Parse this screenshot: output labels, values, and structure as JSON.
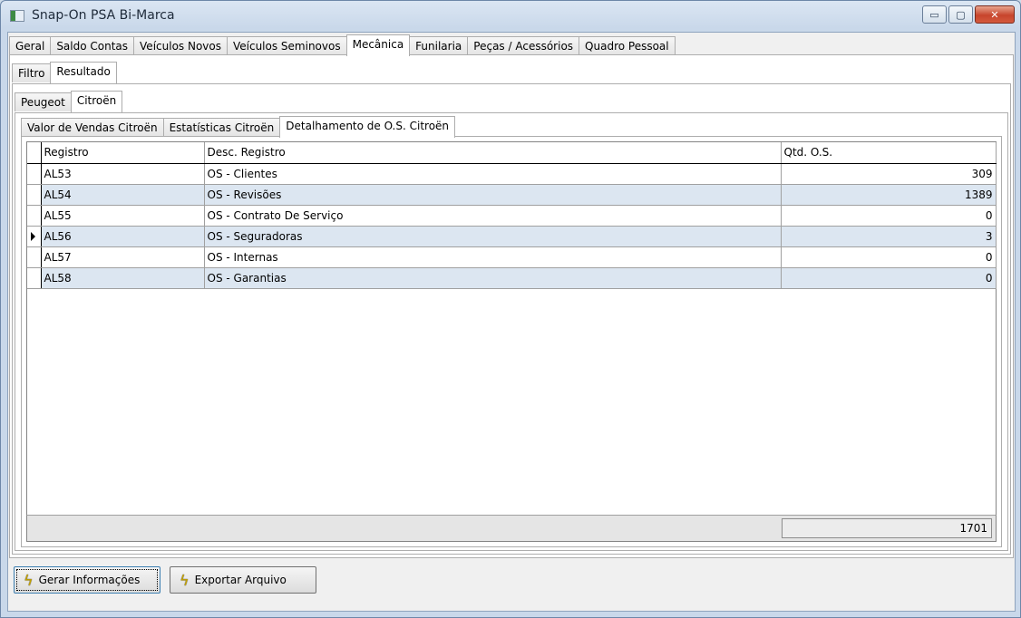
{
  "window": {
    "title": "Snap-On PSA Bi-Marca",
    "buttons": {
      "minimize": "▭",
      "maximize": "▢",
      "close": "✕"
    }
  },
  "main_tabs": [
    "Geral",
    "Saldo Contas",
    "Veículos Novos",
    "Veículos Seminovos",
    "Mecânica",
    "Funilaria",
    "Peças / Acessórios",
    "Quadro Pessoal"
  ],
  "main_tabs_active": "Mecânica",
  "sub_tabs": [
    "Filtro",
    "Resultado"
  ],
  "brand_tabs": [
    "Peugeot",
    "Citroën"
  ],
  "detail_tabs": [
    "Valor de Vendas Citroën",
    "Estatísticas Citroën",
    "Detalhamento de O.S. Citroën"
  ],
  "grid": {
    "headers": [
      "Registro",
      "Desc. Registro",
      "Qtd. O.S."
    ],
    "rows": [
      {
        "registro": "AL53",
        "desc": "OS - Clientes",
        "qtd": "309"
      },
      {
        "registro": "AL54",
        "desc": "OS - Revisões",
        "qtd": "1389"
      },
      {
        "registro": "AL55",
        "desc": "OS - Contrato De Serviço",
        "qtd": "0"
      },
      {
        "registro": "AL56",
        "desc": "OS - Seguradoras",
        "qtd": "3"
      },
      {
        "registro": "AL57",
        "desc": "OS - Internas",
        "qtd": "0"
      },
      {
        "registro": "AL58",
        "desc": "OS - Garantias",
        "qtd": "0"
      }
    ],
    "total": "1701"
  },
  "actions": {
    "gerar": "Gerar Informações",
    "exportar": "Exportar Arquivo",
    "icon": "lightning-bolt-icon"
  }
}
